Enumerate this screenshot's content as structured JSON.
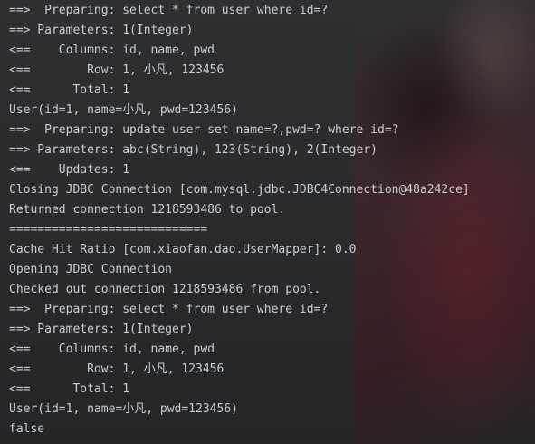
{
  "console": {
    "lines": [
      "==>  Preparing: select * from user where id=?",
      "==> Parameters: 1(Integer)",
      "<==    Columns: id, name, pwd",
      "<==        Row: 1, 小凡, 123456",
      "<==      Total: 1",
      "User(id=1, name=小凡, pwd=123456)",
      "==>  Preparing: update user set name=?,pwd=? where id=?",
      "==> Parameters: abc(String), 123(String), 2(Integer)",
      "<==    Updates: 1",
      "Closing JDBC Connection [com.mysql.jdbc.JDBC4Connection@48a242ce]",
      "Returned connection 1218593486 to pool.",
      "============================",
      "Cache Hit Ratio [com.xiaofan.dao.UserMapper]: 0.0",
      "Opening JDBC Connection",
      "Checked out connection 1218593486 from pool.",
      "==>  Preparing: select * from user where id=?",
      "==> Parameters: 1(Integer)",
      "<==    Columns: id, name, pwd",
      "<==        Row: 1, 小凡, 123456",
      "<==      Total: 1",
      "User(id=1, name=小凡, pwd=123456)",
      "false"
    ]
  }
}
